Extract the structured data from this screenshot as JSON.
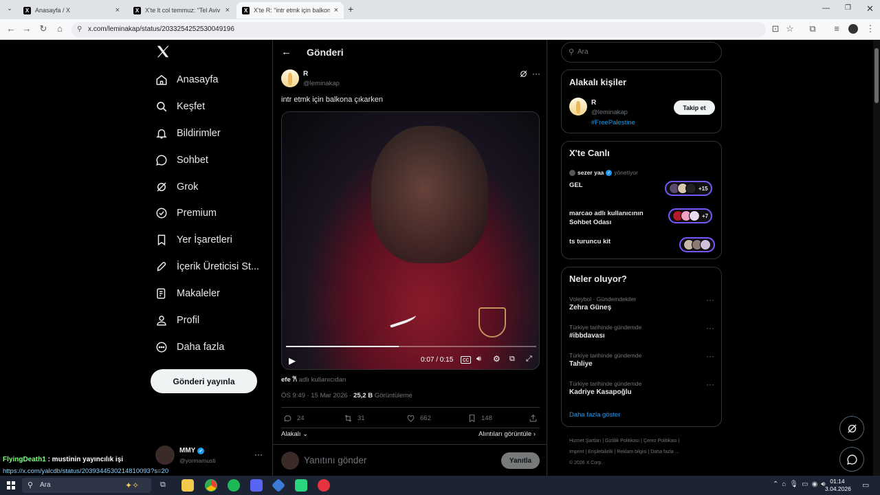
{
  "browser": {
    "tabs": [
      {
        "title": "Anasayfa / X",
        "active": false
      },
      {
        "title": "X'te lt col temmuz: \"Tel Aviv Hi",
        "active": false
      },
      {
        "title": "X'te R: \"intr etmk için balkona ç",
        "active": true
      }
    ],
    "url": "x.com/leminakap/status/2033254252530049196"
  },
  "sidebar": {
    "logo": "X",
    "items": [
      {
        "label": "Anasayfa",
        "icon": "home-icon"
      },
      {
        "label": "Keşfet",
        "icon": "search-icon"
      },
      {
        "label": "Bildirimler",
        "icon": "bell-icon"
      },
      {
        "label": "Sohbet",
        "icon": "chat-icon"
      },
      {
        "label": "Grok",
        "icon": "grok-icon"
      },
      {
        "label": "Premium",
        "icon": "premium-icon"
      },
      {
        "label": "Yer İşaretleri",
        "icon": "bookmark-icon"
      },
      {
        "label": "İçerik Üreticisi St...",
        "icon": "rocket-icon"
      },
      {
        "label": "Makaleler",
        "icon": "article-icon"
      },
      {
        "label": "Profil",
        "icon": "user-icon"
      },
      {
        "label": "Daha fazla",
        "icon": "more-icon"
      }
    ],
    "post_button": "Gönderi yayınla",
    "account": {
      "name": "MMY",
      "handle": "@yormamusti"
    }
  },
  "post": {
    "header": "Gönderi",
    "author": {
      "name": "R",
      "handle": "@leminakap"
    },
    "text": "intr etmk için balkona çıkarken",
    "video": {
      "time": "0:07 / 0:15",
      "progress": 0.45
    },
    "attribution_name": "efe 𐙚",
    "attribution_suffix": "adlı kullanıcıdan",
    "timestamp": "ÖS 9:49 · 15 Mar 2026 · ",
    "views_count": "25,2 B",
    "views_label": "Görüntüleme",
    "stats": {
      "replies": "24",
      "reposts": "31",
      "likes": "662",
      "bookmarks": "148"
    },
    "sort_label": "Alakalı",
    "quotes_link": "Alıntıları görüntüle",
    "reply_placeholder": "Yanıtını gönder",
    "reply_button": "Yanıtla"
  },
  "right": {
    "search_placeholder": "Ara",
    "related": {
      "title": "Alakalı kişiler",
      "name": "R",
      "handle": "@leminakap",
      "bio": "#FreePalestine",
      "follow": "Takip et"
    },
    "live": {
      "title": "X'te Canlı",
      "host": "sezer yaa",
      "host_suffix": "yönetiyor",
      "spaces": [
        {
          "title": "GEL",
          "count": "+15"
        },
        {
          "title": "marcao adlı kullanıcının Sohbet Odası",
          "count": "+7"
        },
        {
          "title": "ts turuncu kit",
          "count": ""
        }
      ]
    },
    "trends": {
      "title": "Neler oluyor?",
      "items": [
        {
          "context": "Voleybol · Gündemdekiler",
          "name": "Zehra Güneş"
        },
        {
          "context": "Türkiye tarihinde gündemde",
          "name": "#ibbdavası"
        },
        {
          "context": "Türkiye tarihinde gündemde",
          "name": "Tahliye"
        },
        {
          "context": "Türkiye tarihinde gündemde",
          "name": "Kadriye Kasapoğlu"
        }
      ],
      "show_more": "Daha fazla göster"
    },
    "footer": [
      "Hizmet Şartları",
      "Gizlilik Politikası",
      "Çerez Politikası",
      "Imprint",
      "Erişilebilirlik",
      "Reklam bilgisi",
      "Daha fazla ...",
      "© 2026 X Corp."
    ]
  },
  "overlay": {
    "user": "FlyingDeath1",
    "message": " : mustinin yayıncılık işi",
    "link": "https://x.com/yalcdb/status/2039344530214810093?s=20"
  },
  "taskbar": {
    "search": "Ara",
    "time": "01:14",
    "date": "3.04.2026"
  },
  "colors": {
    "accent": "#1d9bf0",
    "live": "#7856ff",
    "background": "#000000"
  }
}
